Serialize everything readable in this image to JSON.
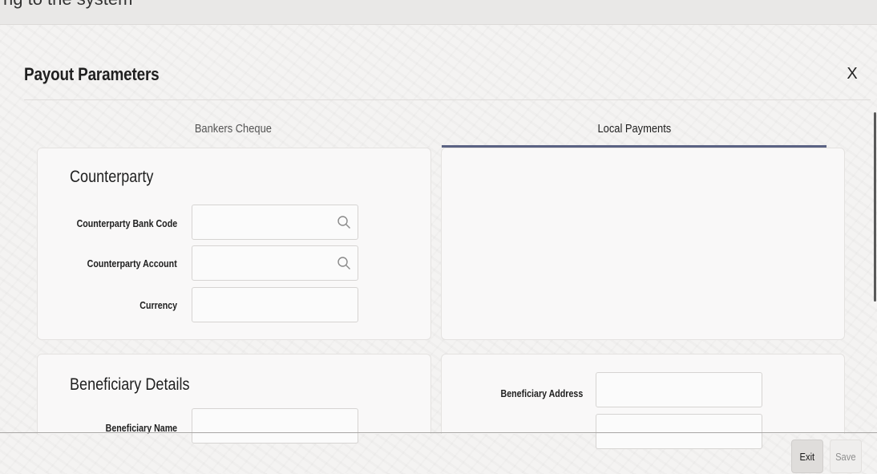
{
  "window": {
    "top_fragment": "ng to the system",
    "title": "Payout Parameters",
    "close_label": "X"
  },
  "tabs": [
    {
      "label": "Bankers Cheque",
      "active": false
    },
    {
      "label": "Local Payments",
      "active": true
    }
  ],
  "counterparty": {
    "heading": "Counterparty",
    "bank_code_label": "Counterparty Bank Code",
    "bank_code_value": "",
    "account_label": "Counterparty Account",
    "account_value": "",
    "currency_label": "Currency",
    "currency_value": ""
  },
  "beneficiary": {
    "heading": "Beneficiary Details",
    "name_label": "Beneficiary Name",
    "name_value": "",
    "address_label": "Beneficiary Address",
    "address_line1": "",
    "address_line2": ""
  },
  "footer": {
    "exit_label": "Exit",
    "save_label": "Save"
  },
  "icons": {
    "lookup": "search-icon"
  },
  "colors": {
    "active_tab_underline": "#5a6283",
    "exit_button_bg": "#dfdddb",
    "save_button_text": "#8f8f8f"
  }
}
